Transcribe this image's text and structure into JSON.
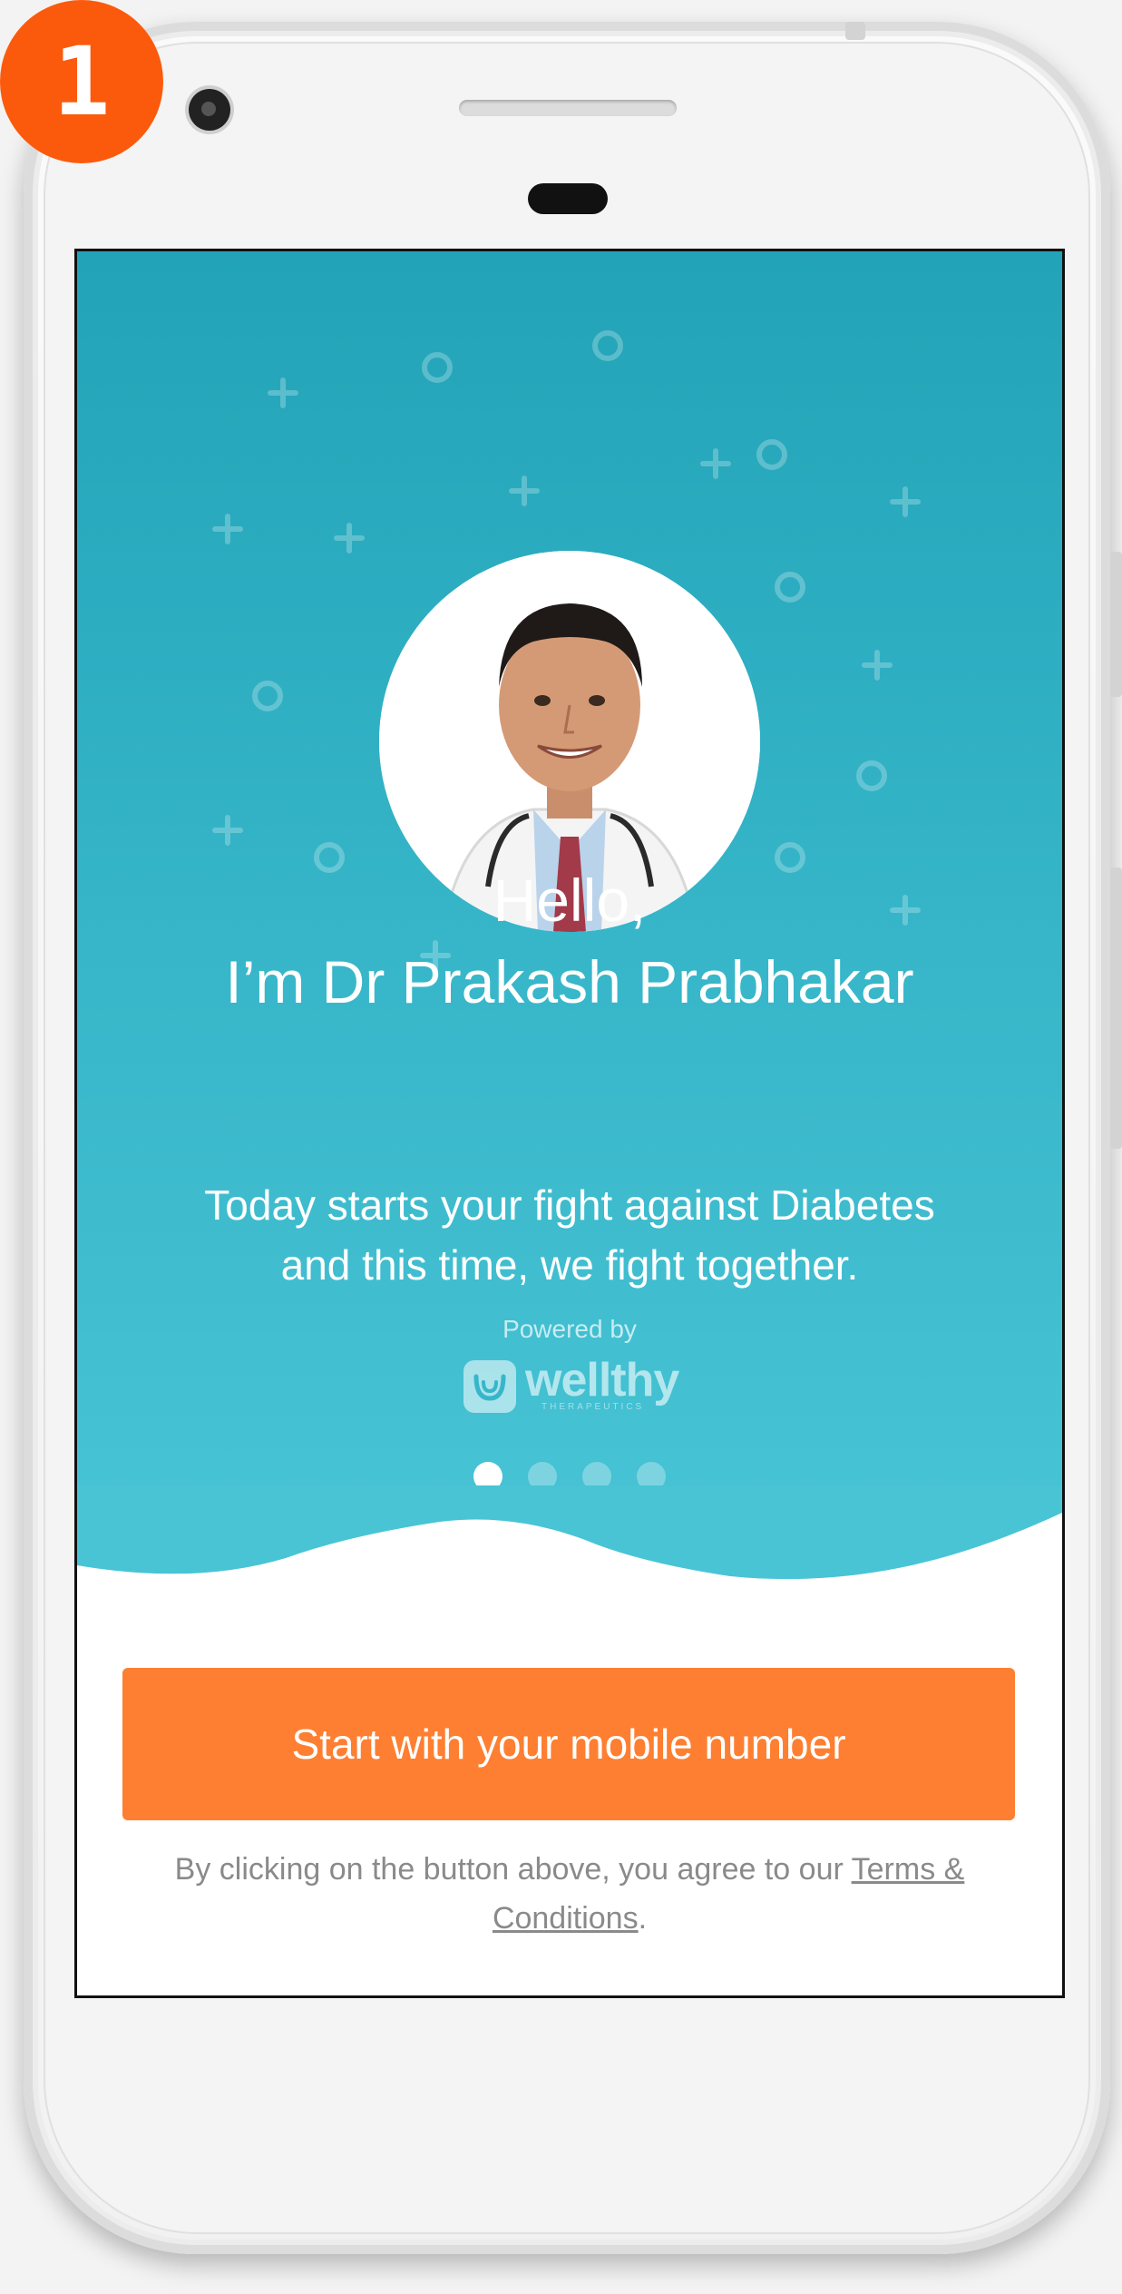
{
  "step_badge": "1",
  "app": {
    "greeting_line1": "Hello,",
    "greeting_line2": "I’m Dr Prakash Prabhakar",
    "subtitle_line1": "Today starts your fight against Diabetes",
    "subtitle_line2": "and this time, we fight together.",
    "powered_by": "Powered by",
    "brand_name": "wellthy",
    "brand_tagline": "THERAPEUTICS",
    "pagination": {
      "total": 4,
      "active": 1
    },
    "cta_label": "Start with your mobile number",
    "terms_prefix": "By clicking on the button above, you agree to our ",
    "terms_link": "Terms & Conditions",
    "terms_suffix": "."
  },
  "colors": {
    "hero_top": "#22a3b7",
    "hero_bottom": "#4ac6d7",
    "cta": "#fe7f31",
    "badge": "#fb5a0c"
  },
  "icons": [
    "plus-decoration-icon",
    "circle-decoration-icon",
    "wellthy-logo-icon",
    "camera-icon"
  ]
}
